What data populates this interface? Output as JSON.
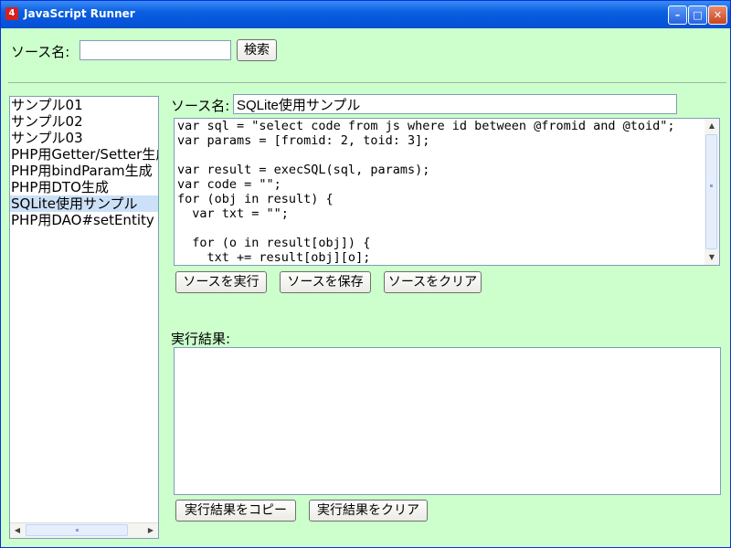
{
  "window": {
    "title": "JavaScript Runner",
    "icon_char": "4",
    "controls": {
      "minimize": "–",
      "maximize": "□",
      "close": "✕"
    }
  },
  "search": {
    "label": "ソース名:",
    "value": "",
    "button": "検索"
  },
  "list": {
    "items": [
      "サンプル01",
      "サンプル02",
      "サンプル03",
      "PHP用Getter/Setter生成",
      "PHP用bindParam生成",
      "PHP用DTO生成",
      "SQLite使用サンプル",
      "PHP用DAO#setEntity"
    ],
    "selected_index": 6
  },
  "editor": {
    "name_label": "ソース名:",
    "name_value": "SQLite使用サンプル",
    "code": "var sql = \"select code from js where id between @fromid and @toid\";\nvar params = [fromid: 2, toid: 3];\n\nvar result = execSQL(sql, params);\nvar code = \"\";\nfor (obj in result) {\n  var txt = \"\";\n\n  for (o in result[obj]) {\n    txt += result[obj][o];",
    "buttons": {
      "run": "ソースを実行",
      "save": "ソースを保存",
      "clear": "ソースをクリア"
    }
  },
  "result": {
    "label": "実行結果:",
    "value": "",
    "buttons": {
      "copy": "実行結果をコピー",
      "clear": "実行結果をクリア"
    }
  }
}
